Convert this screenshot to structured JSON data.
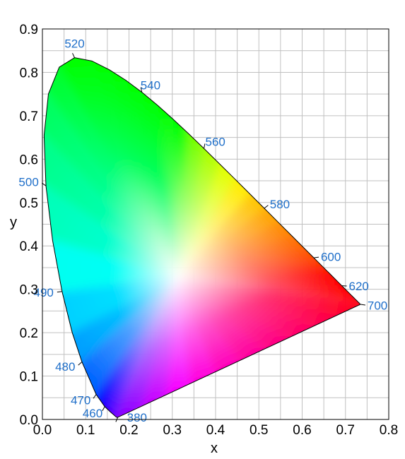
{
  "chart_data": {
    "type": "scatter",
    "xlabel": "x",
    "ylabel": "y",
    "xlim": [
      0,
      0.8
    ],
    "ylim": [
      0,
      0.9
    ],
    "x_ticks": [
      "0.0",
      "0.1",
      "0.2",
      "0.3",
      "0.4",
      "0.5",
      "0.6",
      "0.7",
      "0.8"
    ],
    "y_ticks": [
      "0.0",
      "0.1",
      "0.2",
      "0.3",
      "0.4",
      "0.5",
      "0.6",
      "0.7",
      "0.8",
      "0.9"
    ],
    "grid": true,
    "minor_grid_step": 0.05,
    "spectral_locus": [
      [
        0.1741,
        0.005
      ],
      [
        0.1733,
        0.0048
      ],
      [
        0.1726,
        0.0048
      ],
      [
        0.1714,
        0.0051
      ],
      [
        0.1689,
        0.0069
      ],
      [
        0.1644,
        0.0109
      ],
      [
        0.1566,
        0.0177
      ],
      [
        0.144,
        0.0297
      ],
      [
        0.1241,
        0.0578
      ],
      [
        0.0913,
        0.1327
      ],
      [
        0.0687,
        0.2007
      ],
      [
        0.0454,
        0.295
      ],
      [
        0.0235,
        0.4127
      ],
      [
        0.0082,
        0.5384
      ],
      [
        0.0039,
        0.6548
      ],
      [
        0.0139,
        0.7502
      ],
      [
        0.0389,
        0.812
      ],
      [
        0.0743,
        0.8338
      ],
      [
        0.1142,
        0.8262
      ],
      [
        0.1547,
        0.8059
      ],
      [
        0.1929,
        0.7816
      ],
      [
        0.2296,
        0.7543
      ],
      [
        0.2658,
        0.7243
      ],
      [
        0.3016,
        0.6923
      ],
      [
        0.3373,
        0.6589
      ],
      [
        0.3731,
        0.6245
      ],
      [
        0.4087,
        0.5896
      ],
      [
        0.4441,
        0.5547
      ],
      [
        0.4788,
        0.5202
      ],
      [
        0.5125,
        0.4866
      ],
      [
        0.5448,
        0.4544
      ],
      [
        0.5752,
        0.4242
      ],
      [
        0.6029,
        0.3965
      ],
      [
        0.627,
        0.3725
      ],
      [
        0.6482,
        0.3514
      ],
      [
        0.6658,
        0.334
      ],
      [
        0.6801,
        0.3197
      ],
      [
        0.6915,
        0.3083
      ],
      [
        0.7006,
        0.2993
      ],
      [
        0.7079,
        0.292
      ],
      [
        0.714,
        0.2859
      ],
      [
        0.719,
        0.2809
      ],
      [
        0.723,
        0.277
      ],
      [
        0.726,
        0.274
      ],
      [
        0.7283,
        0.2717
      ],
      [
        0.73,
        0.27
      ],
      [
        0.7311,
        0.2689
      ],
      [
        0.732,
        0.268
      ],
      [
        0.7327,
        0.2673
      ],
      [
        0.7334,
        0.2666
      ],
      [
        0.734,
        0.266
      ],
      [
        0.7344,
        0.2656
      ],
      [
        0.7346,
        0.2654
      ],
      [
        0.7347,
        0.2653
      ]
    ],
    "wavelength_labels": [
      {
        "text": "380",
        "x": 0.1741,
        "y": 0.005,
        "side": "right"
      },
      {
        "text": "460",
        "x": 0.144,
        "y": 0.0297,
        "side": "left"
      },
      {
        "text": "470",
        "x": 0.1241,
        "y": 0.0578,
        "side": "left"
      },
      {
        "text": "480",
        "x": 0.0913,
        "y": 0.1327,
        "side": "left"
      },
      {
        "text": "490",
        "x": 0.0454,
        "y": 0.295,
        "side": "left"
      },
      {
        "text": "500",
        "x": 0.0082,
        "y": 0.5384,
        "side": "left"
      },
      {
        "text": "520",
        "x": 0.0743,
        "y": 0.8338,
        "side": "top"
      },
      {
        "text": "540",
        "x": 0.2296,
        "y": 0.7543,
        "side": "right"
      },
      {
        "text": "560",
        "x": 0.3731,
        "y": 0.6245,
        "side": "right"
      },
      {
        "text": "580",
        "x": 0.5125,
        "y": 0.4866,
        "side": "right"
      },
      {
        "text": "600",
        "x": 0.627,
        "y": 0.3725,
        "side": "right"
      },
      {
        "text": "620",
        "x": 0.6915,
        "y": 0.3083,
        "side": "right"
      },
      {
        "text": "700",
        "x": 0.7347,
        "y": 0.2653,
        "side": "right"
      }
    ],
    "white_point": [
      0.3127,
      0.329
    ]
  },
  "colors": {
    "wavelength_label": "#1f6fc9",
    "grid": "#c0c0c0",
    "axis": "#000000",
    "background": "#ffffff"
  }
}
